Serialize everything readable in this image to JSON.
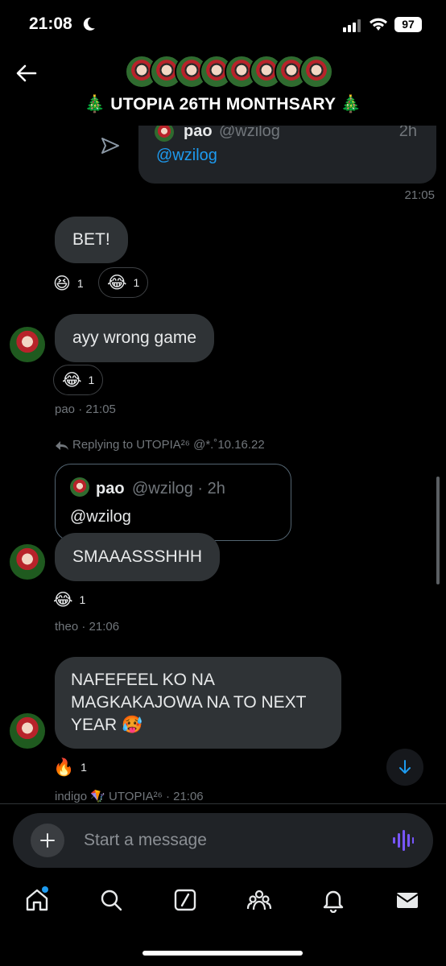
{
  "status": {
    "time": "21:08",
    "battery": "97"
  },
  "header": {
    "title": "🎄 UTOPIA 26TH MONTHSARY 🎄",
    "avatar_count": 8
  },
  "chat": {
    "quoted_top": {
      "name": "pao",
      "handle": "@wzilog",
      "time": "2h",
      "body": "@wzilog",
      "sent_time": "21:05"
    },
    "messages": [
      {
        "text": "BET!",
        "reactions": [
          {
            "emoji": "😆",
            "count": "1"
          },
          {
            "emoji": "😂",
            "count": "1"
          }
        ]
      },
      {
        "text": "ayy wrong game",
        "reactions": [
          {
            "emoji": "😂",
            "count": "1"
          }
        ],
        "meta": "pao · 21:05"
      },
      {
        "reply_to": "Replying to UTOPIA²⁶ @*.˚10.16.22",
        "quote": {
          "name": "pao",
          "handle": "@wzilog · 2h",
          "body": "@wzilog"
        },
        "text": "SMAAASSSHHH",
        "reactions": [
          {
            "emoji": "😂",
            "count": "1"
          }
        ],
        "meta": "theo · 21:06"
      },
      {
        "text": "NAFEFEEL KO NA MAGKAKAJOWA NA TO NEXT YEAR 🥵",
        "reactions": [
          {
            "emoji": "🔥",
            "count": "1"
          }
        ],
        "meta": "indigo 🪁 UTOPIA²⁶ · 21:06"
      }
    ]
  },
  "composer": {
    "placeholder": "Start a message"
  },
  "colors": {
    "bubble": "#2f3336",
    "accent": "#1d9bf0",
    "voice": "#7856ff",
    "background": "#000000"
  },
  "tabs": [
    "home-icon",
    "search-icon",
    "grok-icon",
    "communities-icon",
    "notifications-icon",
    "messages-icon"
  ]
}
